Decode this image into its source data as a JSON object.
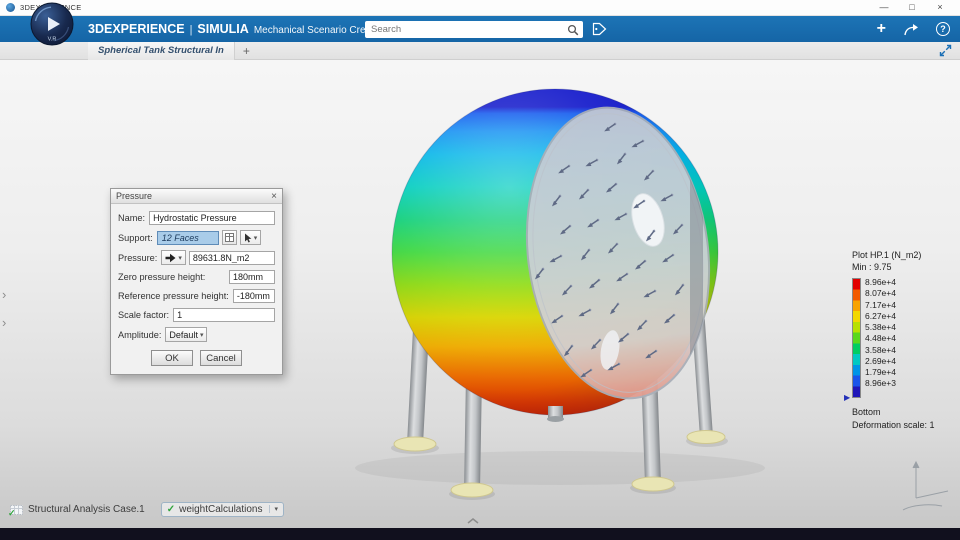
{
  "titlebar": {
    "title": "3DEXPERIENCE"
  },
  "window_controls": {
    "minimize": "—",
    "maximize": "□",
    "close": "×"
  },
  "header": {
    "brand": "3DEXPERIENCE",
    "separator": "|",
    "app": "SIMULIA",
    "subtitle": "Mechanical Scenario Creation",
    "logo_text": "V.R",
    "search": {
      "placeholder": "Search"
    },
    "plus": "+",
    "help": "?"
  },
  "tabs": {
    "active": "Spherical Tank Structural In",
    "add": "+"
  },
  "dialog": {
    "title": "Pressure",
    "close": "×",
    "name_label": "Name:",
    "name_value": "Hydrostatic Pressure",
    "support_label": "Support:",
    "support_value": "12 Faces",
    "pressure_label": "Pressure:",
    "pressure_value": "89631.8N_m2",
    "zero_height_label": "Zero pressure height:",
    "zero_height_value": "180mm",
    "ref_height_label": "Reference pressure height:",
    "ref_height_value": "-180mm",
    "scale_label": "Scale factor:",
    "scale_value": "1",
    "amplitude_label": "Amplitude:",
    "amplitude_value": "Default",
    "ok_label": "OK",
    "cancel_label": "Cancel"
  },
  "legend": {
    "title": "Plot HP.1 (N_m2)",
    "min": "Min : 9.75",
    "ticks": [
      "8.96e+4",
      "8.07e+4",
      "7.17e+4",
      "6.27e+4",
      "5.38e+4",
      "4.48e+4",
      "3.58e+4",
      "2.69e+4",
      "1.79e+4",
      "8.96e+3"
    ],
    "bottom": "Bottom",
    "deformation": "Deformation scale: 1",
    "colors": [
      "#e20000",
      "#f25a00",
      "#f8a300",
      "#f2d800",
      "#b8e100",
      "#59d81c",
      "#00cd62",
      "#00c9c2",
      "#0095e6",
      "#1a55ea",
      "#2017b8"
    ]
  },
  "statusbar": {
    "case_label": "Structural Analysis Case.1",
    "weight_label": "weightCalculations"
  },
  "icons": {
    "check": "✓",
    "caret": "▾",
    "chevron": "›",
    "min_marker": "▶"
  },
  "colors": {
    "appbar": "#1a6cb0",
    "support_highlight": "#a9cce9"
  }
}
